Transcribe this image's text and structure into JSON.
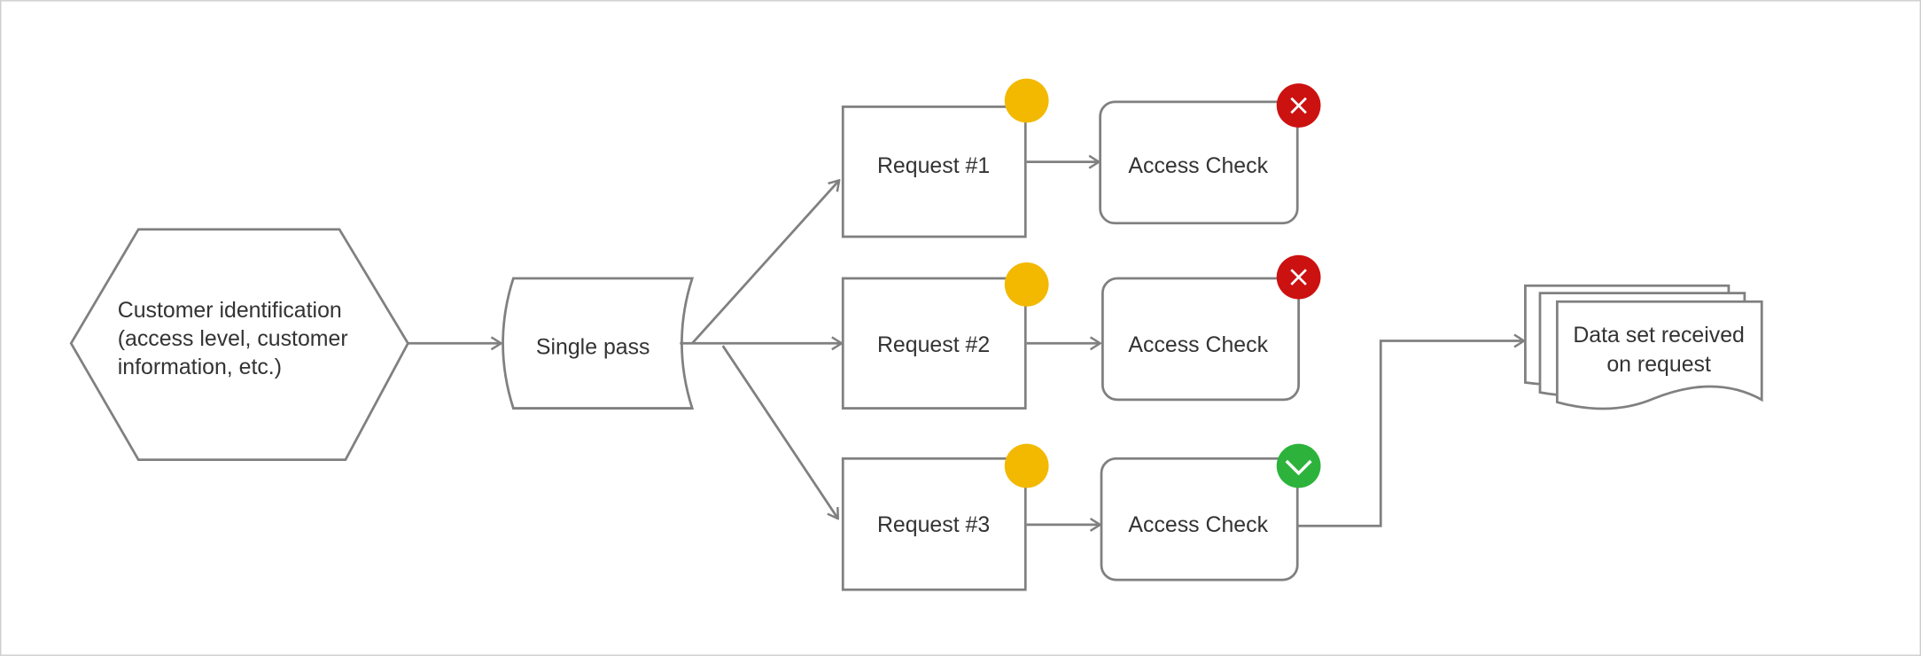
{
  "nodes": {
    "customer": [
      "Customer identification",
      "(access level, customer",
      "information, etc.)"
    ],
    "single_pass": "Single pass",
    "requests": [
      "Request #1",
      "Request #2",
      "Request #3"
    ],
    "access_checks": [
      {
        "label": "Access Check",
        "status": "denied",
        "icon": "close-icon",
        "color": "#cc1111"
      },
      {
        "label": "Access Check",
        "status": "denied",
        "icon": "close-icon",
        "color": "#cc1111"
      },
      {
        "label": "Access Check",
        "status": "granted",
        "icon": "check-icon",
        "color": "#2db33b"
      }
    ],
    "request_status_color": "#f2b900",
    "result": [
      "Data set received",
      "on request"
    ]
  }
}
